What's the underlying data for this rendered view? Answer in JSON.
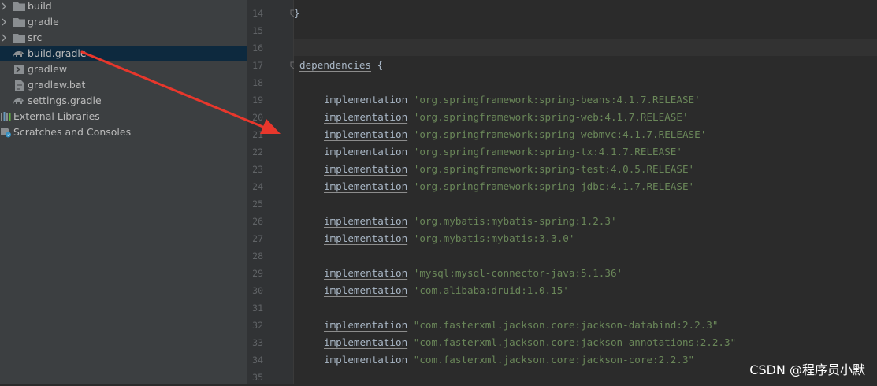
{
  "project_tree": {
    "items": [
      {
        "label": "build",
        "icon": "folder-icon",
        "expandable": true
      },
      {
        "label": "gradle",
        "icon": "folder-icon",
        "expandable": true
      },
      {
        "label": "src",
        "icon": "folder-icon",
        "expandable": true
      },
      {
        "label": "build.gradle",
        "icon": "gradle-elephant-icon",
        "expandable": false,
        "selected": true
      },
      {
        "label": "gradlew",
        "icon": "shell-script-icon",
        "expandable": false
      },
      {
        "label": "gradlew.bat",
        "icon": "batch-file-icon",
        "expandable": false
      },
      {
        "label": "settings.gradle",
        "icon": "gradle-elephant-icon",
        "expandable": false
      },
      {
        "label": "External Libraries",
        "icon": "library-bars-icon",
        "expandable": true
      },
      {
        "label": "Scratches and Consoles",
        "icon": "scratches-icon",
        "expandable": false
      }
    ]
  },
  "editor": {
    "line_numbers": [
      "14",
      "15",
      "16",
      "17",
      "18",
      "19",
      "20",
      "21",
      "22",
      "23",
      "24",
      "25",
      "26",
      "27",
      "28",
      "29",
      "30",
      "31",
      "32",
      "33",
      "34",
      "35"
    ],
    "closing_brace": "}",
    "dependencies_keyword": "dependencies",
    "open_brace": "{",
    "dependency_keyword": "implementation",
    "dependencies": [
      {
        "line": "19",
        "value": "'org.springframework:spring-beans:4.1.7.RELEASE'"
      },
      {
        "line": "20",
        "value": "'org.springframework:spring-web:4.1.7.RELEASE'"
      },
      {
        "line": "21",
        "value": "'org.springframework:spring-webmvc:4.1.7.RELEASE'"
      },
      {
        "line": "22",
        "value": "'org.springframework:spring-tx:4.1.7.RELEASE'"
      },
      {
        "line": "23",
        "value": "'org.springframework:spring-test:4.0.5.RELEASE'"
      },
      {
        "line": "24",
        "value": "'org.springframework:spring-jdbc:4.1.7.RELEASE'"
      },
      {
        "line": "26",
        "value": "'org.mybatis:mybatis-spring:1.2.3'"
      },
      {
        "line": "27",
        "value": "'org.mybatis:mybatis:3.3.0'"
      },
      {
        "line": "29",
        "value": "'mysql:mysql-connector-java:5.1.36'"
      },
      {
        "line": "30",
        "value": "'com.alibaba:druid:1.0.15'"
      },
      {
        "line": "32",
        "value": "\"com.fasterxml.jackson.core:jackson-databind:2.2.3\""
      },
      {
        "line": "33",
        "value": "\"com.fasterxml.jackson.core:jackson-annotations:2.2.3\""
      },
      {
        "line": "34",
        "value": "\"com.fasterxml.jackson.core:jackson-core:2.2.3\""
      }
    ]
  },
  "watermark": "CSDN @程序员小默",
  "colors": {
    "tree_bg": "#3c3f41",
    "editor_bg": "#2b2b2b",
    "string": "#6a8759",
    "selection": "#0d293e",
    "arrow": "#e8372c"
  }
}
